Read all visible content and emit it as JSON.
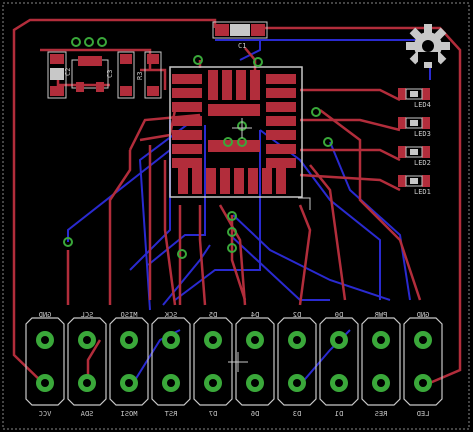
{
  "board": {
    "colors": {
      "background": "#000000",
      "top_copper": "#b22d3b",
      "bottom_copper": "#2a2ad0",
      "silk": "#c8c8c8",
      "pad": "#3aa83a",
      "outline": "#888888"
    }
  },
  "logo": {
    "icon": "gear-icon"
  },
  "parts": {
    "c1": "C1",
    "c2": "C2",
    "c3": "C3",
    "r3": "R3"
  },
  "leds": [
    {
      "label": "LED4"
    },
    {
      "label": "LED3"
    },
    {
      "label": "LED2"
    },
    {
      "label": "LED1"
    }
  ],
  "header_top": [
    "GND",
    "SCL",
    "MISO",
    "SCK",
    "D5",
    "D4",
    "D2",
    "D0",
    "PWR",
    "GND"
  ],
  "header_bottom": [
    "VCC",
    "SDA",
    "MOSI",
    "RST",
    "D7",
    "D6",
    "D3",
    "D1",
    "RES",
    "LED"
  ]
}
